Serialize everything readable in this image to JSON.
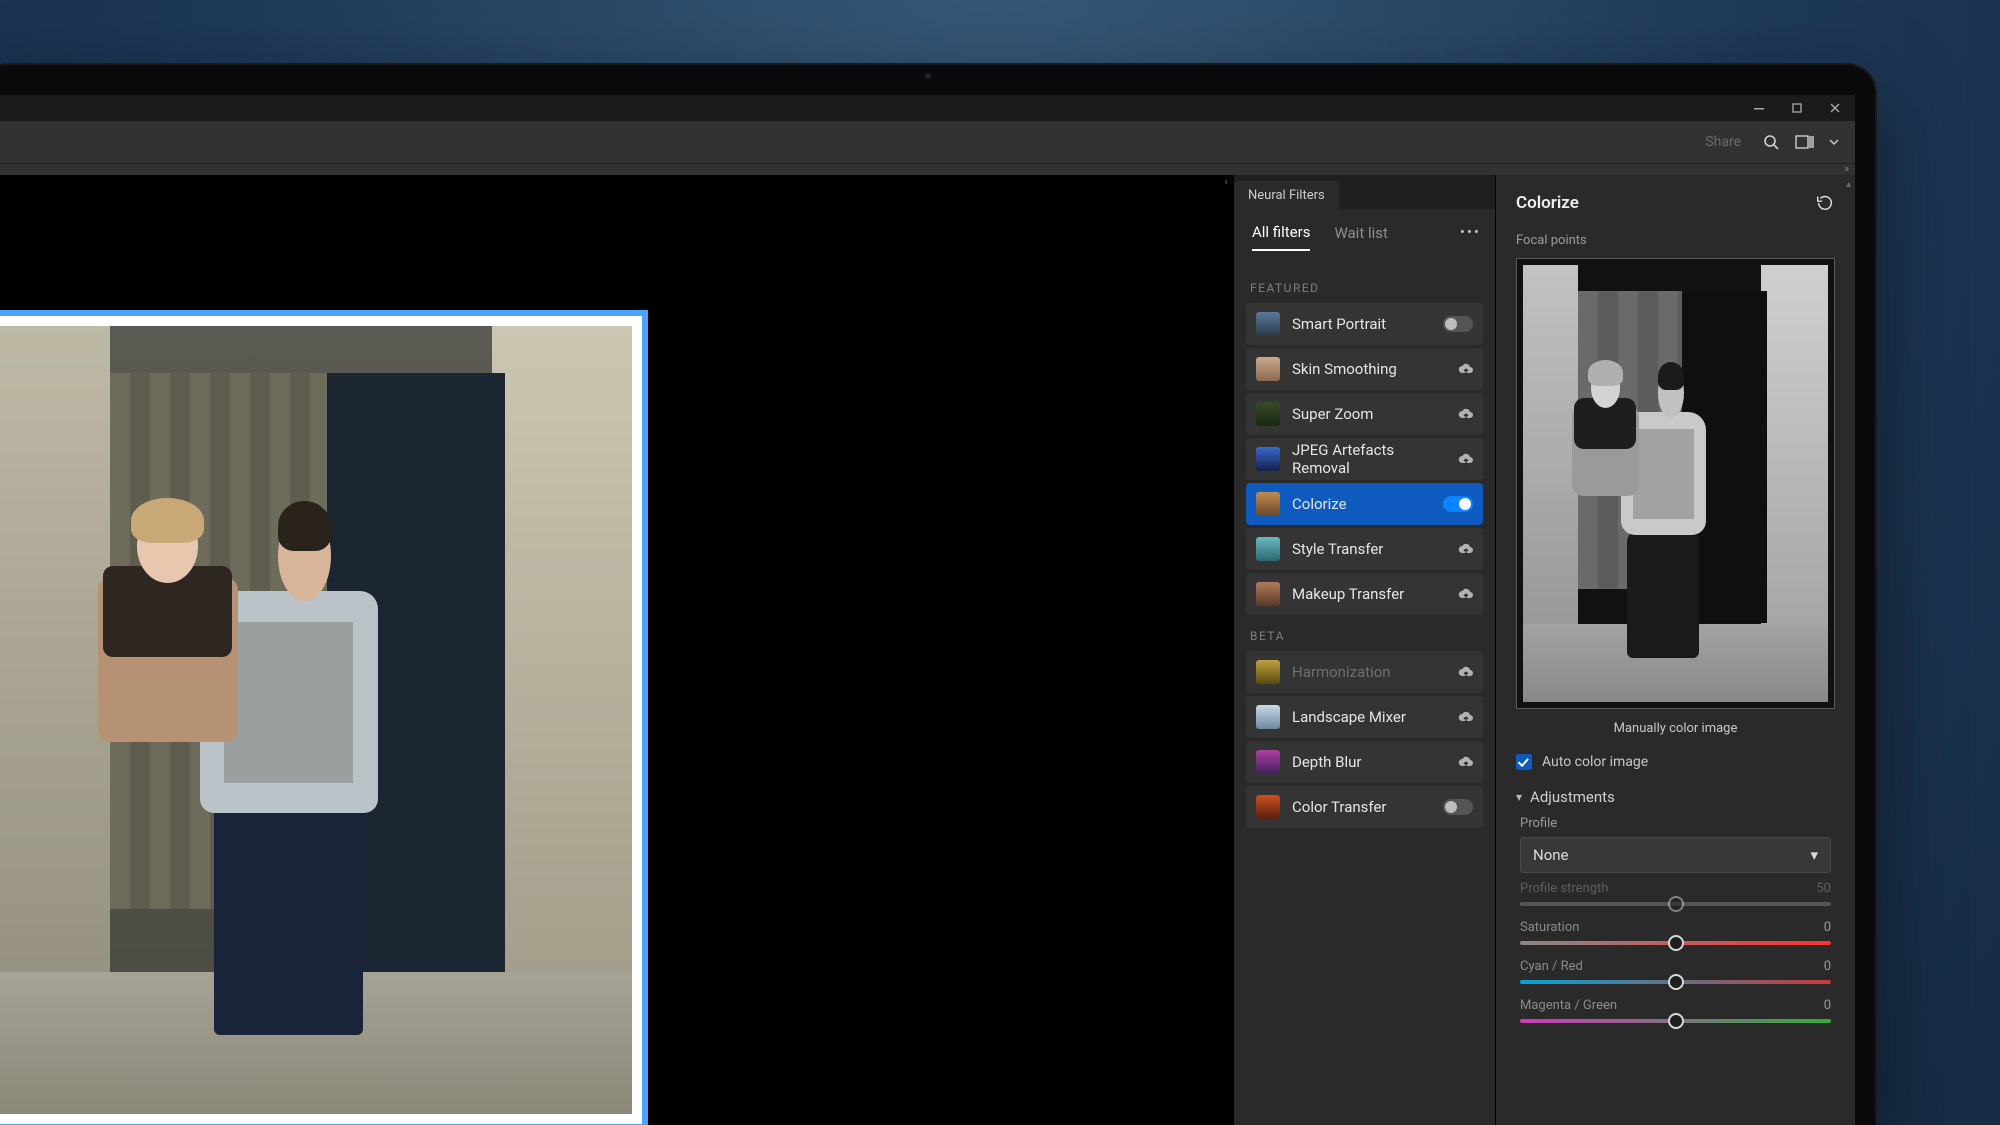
{
  "window": {
    "share_label": "Share"
  },
  "panel": {
    "tab_label": "Neural Filters",
    "tabs": {
      "all": "All filters",
      "wait": "Wait list"
    },
    "sections": {
      "featured": "FEATURED",
      "beta": "BETA"
    },
    "filters": {
      "featured": [
        {
          "name": "Smart Portrait",
          "state": "toggle-off",
          "thumb": "linear-gradient(#5a7a9a,#2a3a4a)"
        },
        {
          "name": "Skin Smoothing",
          "state": "cloud",
          "thumb": "linear-gradient(#caa98c,#8a6a50)"
        },
        {
          "name": "Super Zoom",
          "state": "cloud",
          "thumb": "linear-gradient(#3a4a2a,#1a2a12)"
        },
        {
          "name": "JPEG Artefacts Removal",
          "state": "cloud",
          "thumb": "linear-gradient(#3a6ad0,#12204a)"
        },
        {
          "name": "Colorize",
          "state": "toggle-on",
          "thumb": "linear-gradient(#c08a50,#6a4a2a)",
          "active": true
        },
        {
          "name": "Style Transfer",
          "state": "cloud",
          "thumb": "linear-gradient(#6ab8c0,#2a6a70)"
        },
        {
          "name": "Makeup Transfer",
          "state": "cloud",
          "thumb": "linear-gradient(#b07a5a,#5a3a2a)"
        }
      ],
      "beta": [
        {
          "name": "Harmonization",
          "state": "cloud",
          "thumb": "linear-gradient(#c0a040,#5a4a10)",
          "dim": true
        },
        {
          "name": "Landscape Mixer",
          "state": "cloud",
          "thumb": "linear-gradient(#c8d8e8,#6a8aa0)"
        },
        {
          "name": "Depth Blur",
          "state": "cloud",
          "thumb": "linear-gradient(#b040a0,#402060)"
        },
        {
          "name": "Color Transfer",
          "state": "toggle-off",
          "thumb": "linear-gradient(#d05020,#5a2010)"
        }
      ]
    }
  },
  "props": {
    "title": "Colorize",
    "focal_label": "Focal points",
    "preview_caption": "Manually color image",
    "auto_color": {
      "label": "Auto color image",
      "checked": true
    },
    "adjustments_label": "Adjustments",
    "profile": {
      "label": "Profile",
      "value": "None"
    },
    "sliders": {
      "profile_strength": {
        "label": "Profile strength",
        "value": 50,
        "pos": 50,
        "disabled": true,
        "track": "plain"
      },
      "saturation": {
        "label": "Saturation",
        "value": 0,
        "pos": 50,
        "track": "sat"
      },
      "cyan_red": {
        "label": "Cyan / Red",
        "value": 0,
        "pos": 50,
        "track": "cr"
      },
      "magenta_green": {
        "label": "Magenta / Green",
        "value": 0,
        "pos": 50,
        "track": "mg"
      }
    }
  }
}
